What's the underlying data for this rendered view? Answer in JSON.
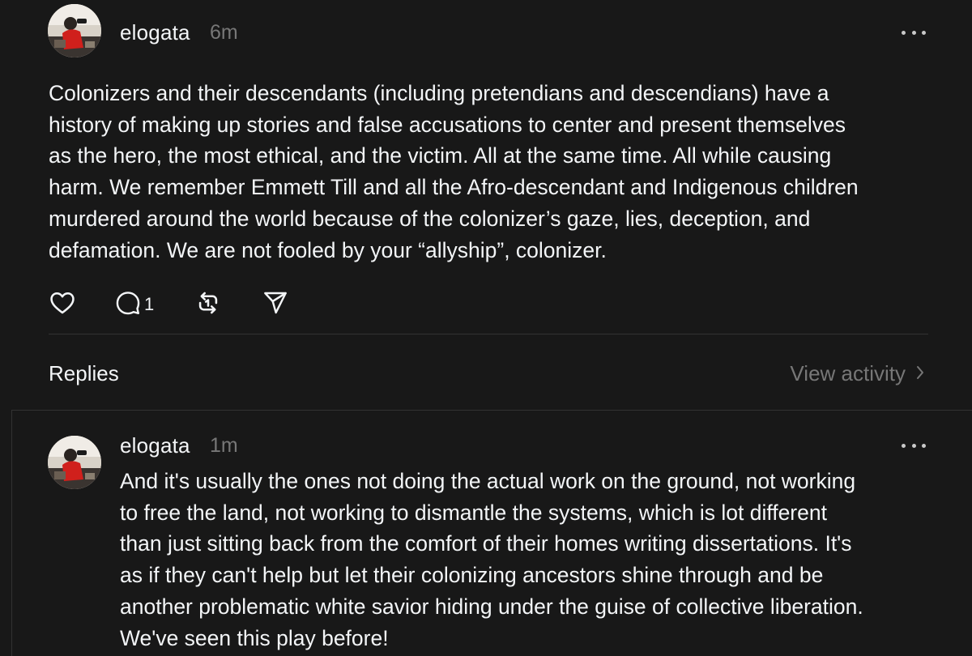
{
  "post": {
    "username": "elogata",
    "timestamp": "6m",
    "text": "Colonizers and their descendants (including pretendians and descendians) have a\nhistory of making up stories and false accusations to center and present themselves\nas the hero, the most ethical, and the victim. All at the same time. All while causing\nharm. We remember Emmett Till and all the Afro-descendant and Indigenous children\nmurdered around the world because of the colonizer’s gaze, lies, deception, and\ndefamation. We are not fooled by your “allyship”, colonizer.",
    "actions": {
      "like_icon": "heart-icon",
      "reply_icon": "comment-icon",
      "reply_count": "1",
      "repost_icon": "repost-icon",
      "share_icon": "send-icon"
    }
  },
  "replies_section": {
    "title": "Replies",
    "view_activity_label": "View activity"
  },
  "reply": {
    "username": "elogata",
    "timestamp": "1m",
    "text": "And it's usually the ones not doing the actual work on the ground, not working\nto free the land, not working to dismantle the systems, which is lot different\nthan just sitting back from the comfort of their homes writing dissertations. It's\nas if they can't help but let their colonizing ancestors shine through and be\nanother problematic white savior hiding under the guise of collective liberation.\nWe've seen this play before!"
  },
  "colors": {
    "background": "#181818",
    "text_primary": "#f3f5f7",
    "text_secondary": "#777777",
    "divider": "#323232"
  }
}
